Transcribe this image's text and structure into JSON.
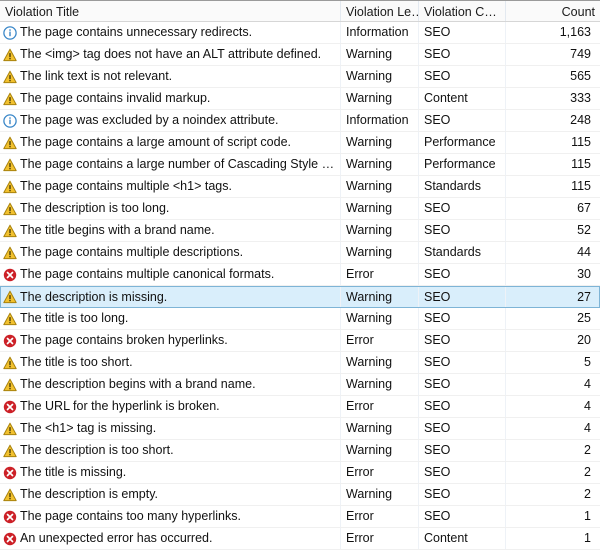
{
  "table": {
    "columns": [
      {
        "key": "title",
        "label": "Violation Title",
        "align": "left"
      },
      {
        "key": "level",
        "label": "Violation Le…",
        "align": "left"
      },
      {
        "key": "category",
        "label": "Violation C…",
        "align": "left"
      },
      {
        "key": "count",
        "label": "Count",
        "align": "right"
      }
    ],
    "selected_row_index": 12,
    "colors": {
      "header_background": "#fafafa",
      "selection_background": "#d9eefb",
      "selection_border": "#7eb4d6",
      "info_icon": "#3a87c8",
      "warning_icon": "#f2c12e",
      "error_icon": "#cc2027",
      "row_separator": "#f0f0f0"
    },
    "rows": [
      {
        "icon": "info-icon",
        "title": "The page contains unnecessary redirects.",
        "level": "Information",
        "category": "SEO",
        "count": "1,163"
      },
      {
        "icon": "warning-icon",
        "title": "The <img> tag does not have an ALT attribute defined.",
        "level": "Warning",
        "category": "SEO",
        "count": "749"
      },
      {
        "icon": "warning-icon",
        "title": "The link text is not relevant.",
        "level": "Warning",
        "category": "SEO",
        "count": "565"
      },
      {
        "icon": "warning-icon",
        "title": "The page contains invalid markup.",
        "level": "Warning",
        "category": "Content",
        "count": "333"
      },
      {
        "icon": "info-icon",
        "title": "The page was excluded by a noindex attribute.",
        "level": "Information",
        "category": "SEO",
        "count": "248"
      },
      {
        "icon": "warning-icon",
        "title": "The page contains a large amount of script code.",
        "level": "Warning",
        "category": "Performance",
        "count": "115"
      },
      {
        "icon": "warning-icon",
        "title": "The page contains  a large number of Cascading Style …",
        "level": "Warning",
        "category": "Performance",
        "count": "115"
      },
      {
        "icon": "warning-icon",
        "title": "The page contains multiple <h1> tags.",
        "level": "Warning",
        "category": "Standards",
        "count": "115"
      },
      {
        "icon": "warning-icon",
        "title": "The description is too long.",
        "level": "Warning",
        "category": "SEO",
        "count": "67"
      },
      {
        "icon": "warning-icon",
        "title": "The title begins with a brand name.",
        "level": "Warning",
        "category": "SEO",
        "count": "52"
      },
      {
        "icon": "warning-icon",
        "title": "The page contains multiple descriptions.",
        "level": "Warning",
        "category": "Standards",
        "count": "44"
      },
      {
        "icon": "error-icon",
        "title": "The page contains multiple canonical formats.",
        "level": "Error",
        "category": "SEO",
        "count": "30"
      },
      {
        "icon": "warning-icon",
        "title": "The description is missing.",
        "level": "Warning",
        "category": "SEO",
        "count": "27"
      },
      {
        "icon": "warning-icon",
        "title": "The title is too long.",
        "level": "Warning",
        "category": "SEO",
        "count": "25"
      },
      {
        "icon": "error-icon",
        "title": "The page contains broken hyperlinks.",
        "level": "Error",
        "category": "SEO",
        "count": "20"
      },
      {
        "icon": "warning-icon",
        "title": "The title is too short.",
        "level": "Warning",
        "category": "SEO",
        "count": "5"
      },
      {
        "icon": "warning-icon",
        "title": "The description begins with a brand name.",
        "level": "Warning",
        "category": "SEO",
        "count": "4"
      },
      {
        "icon": "error-icon",
        "title": "The URL for the hyperlink is broken.",
        "level": "Error",
        "category": "SEO",
        "count": "4"
      },
      {
        "icon": "warning-icon",
        "title": "The <h1> tag is missing.",
        "level": "Warning",
        "category": "SEO",
        "count": "4"
      },
      {
        "icon": "warning-icon",
        "title": "The description is too short.",
        "level": "Warning",
        "category": "SEO",
        "count": "2"
      },
      {
        "icon": "error-icon",
        "title": "The title is missing.",
        "level": "Error",
        "category": "SEO",
        "count": "2"
      },
      {
        "icon": "warning-icon",
        "title": "The description is empty.",
        "level": "Warning",
        "category": "SEO",
        "count": "2"
      },
      {
        "icon": "error-icon",
        "title": "The page contains too many hyperlinks.",
        "level": "Error",
        "category": "SEO",
        "count": "1"
      },
      {
        "icon": "error-icon",
        "title": "An unexpected error has occurred.",
        "level": "Error",
        "category": "Content",
        "count": "1"
      }
    ]
  }
}
